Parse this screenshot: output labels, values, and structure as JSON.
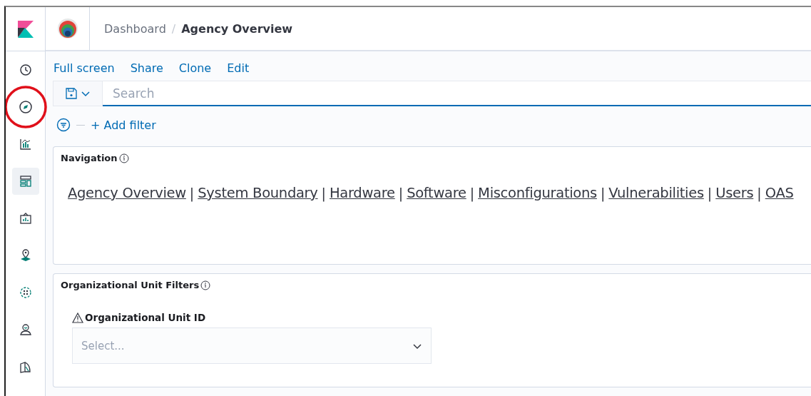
{
  "sidebar": {
    "items": [
      {
        "kind": "clock",
        "selected": false,
        "annotated": false
      },
      {
        "kind": "compass",
        "selected": false,
        "annotated": true
      },
      {
        "kind": "chart",
        "selected": false,
        "annotated": false
      },
      {
        "kind": "dashboard",
        "selected": true,
        "annotated": false
      },
      {
        "kind": "canvas",
        "selected": false,
        "annotated": false
      },
      {
        "kind": "map",
        "selected": false,
        "annotated": false
      },
      {
        "kind": "cluster",
        "selected": false,
        "annotated": false
      },
      {
        "kind": "person",
        "selected": false,
        "annotated": false
      },
      {
        "kind": "book",
        "selected": false,
        "annotated": false
      }
    ]
  },
  "header": {
    "breadcrumbs": [
      "Dashboard",
      "Agency Overview"
    ],
    "separator": "/"
  },
  "toolbar": {
    "links": [
      "Full screen",
      "Share",
      "Clone",
      "Edit"
    ]
  },
  "search": {
    "placeholder": "Search"
  },
  "filters": {
    "add_label": "+ Add filter"
  },
  "panels": [
    {
      "kind": "navigation",
      "title": "Navigation",
      "links": [
        "Agency Overview",
        "System Boundary",
        "Hardware",
        "Software",
        "Misconfigurations",
        "Vulnerabilities",
        "Users",
        "OAS"
      ],
      "separator": "|"
    },
    {
      "kind": "filters",
      "title": "Organizational Unit Filters",
      "field_label": "Organizational Unit ID",
      "placeholder": "Select..."
    }
  ]
}
